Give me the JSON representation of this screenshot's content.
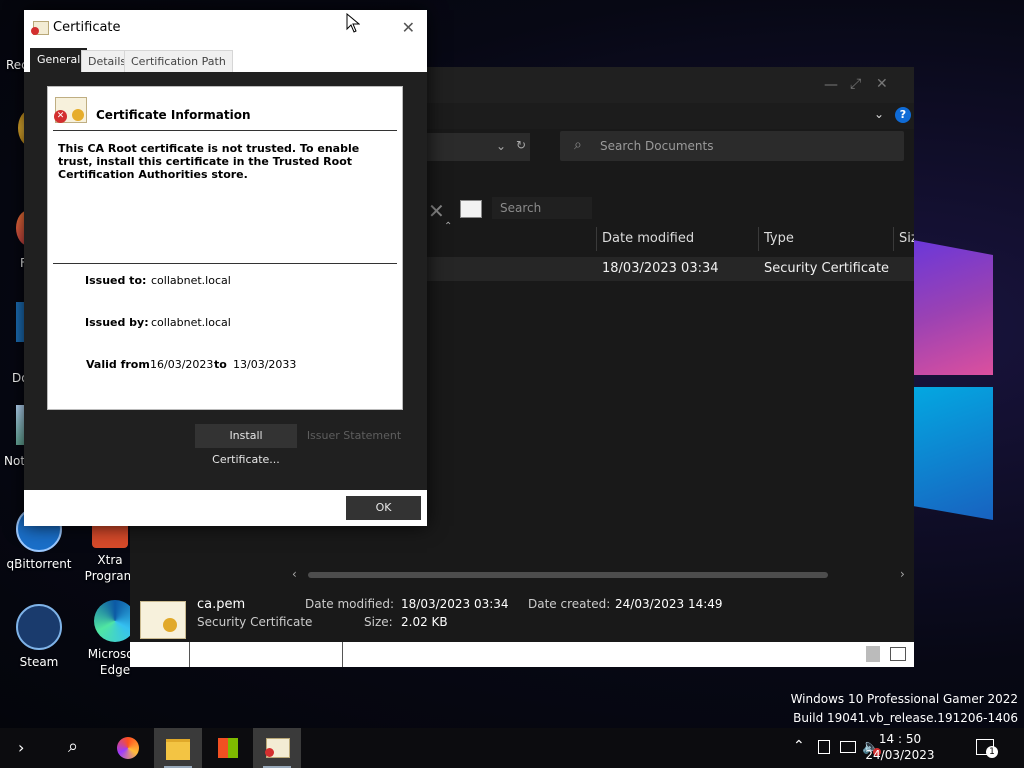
{
  "desktop": {
    "icons": [
      {
        "label": "qBittorrent"
      },
      {
        "label": "Xtra Program"
      },
      {
        "label": "Steam"
      },
      {
        "label": "Microsoft Edge"
      }
    ],
    "partial_labels": [
      "Rec",
      "F",
      "Do",
      "Not"
    ],
    "watermark": {
      "line1": "Windows 10 Professional Gamer 2022",
      "line2": "Build 19041.vb_release.191206-1406"
    }
  },
  "explorer": {
    "search_placeholder": "Search Documents",
    "inline_search_placeholder": "Search",
    "columns": [
      "Date modified",
      "Type",
      "Siz"
    ],
    "file_row": {
      "date_modified": "18/03/2023 03:34",
      "type": "Security Certificate"
    },
    "details": {
      "name": "ca.pem",
      "type": "Security Certificate",
      "date_modified_label": "Date modified:",
      "date_modified": "18/03/2023 03:34",
      "date_created_label": "Date created:",
      "date_created": "24/03/2023 14:49",
      "size_label": "Size:",
      "size": "2.02 KB"
    }
  },
  "certificate": {
    "title": "Certificate",
    "tabs": [
      "General",
      "Details",
      "Certification Path"
    ],
    "heading": "Certificate Information",
    "warning": "This CA Root certificate is not trusted. To enable trust, install this certificate in the Trusted Root Certification Authorities store.",
    "issued_to_label": "Issued to:",
    "issued_to": "collabnet.local",
    "issued_by_label": "Issued by:",
    "issued_by": "collabnet.local",
    "valid_from_label": "Valid from",
    "valid_from": "16/03/2023",
    "to_label": "to",
    "valid_to": "13/03/2033",
    "install_button": "Install Certificate...",
    "issuer_button": "Issuer Statement",
    "ok_button": "OK"
  },
  "taskbar": {
    "time": "14 : 50",
    "date": "24/03/2023",
    "notification_count": "1"
  },
  "colors": {
    "dialog_bg": "#202020",
    "explorer_bg": "#191919",
    "accent": "#0078d7",
    "error_red": "#d32f2f"
  }
}
